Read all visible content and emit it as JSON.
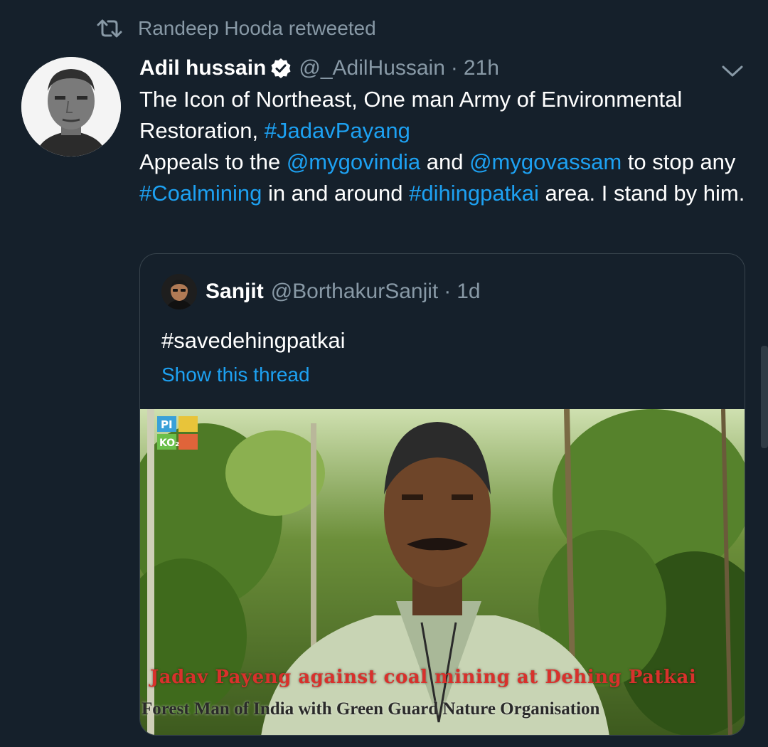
{
  "retweet_context": {
    "text": "Randeep Hooda retweeted"
  },
  "tweet": {
    "author_name": "Adil hussain",
    "author_handle": "@_AdilHussain",
    "separator": "·",
    "time": "21h",
    "verified": true,
    "body": [
      {
        "text": "The Icon of Northeast, One man Army of Environmental Restoration, ",
        "link": false
      },
      {
        "text": "#JadavPayang",
        "link": true
      },
      {
        "text": "\nAppeals to the ",
        "link": false
      },
      {
        "text": "@mygovindia",
        "link": true
      },
      {
        "text": " and ",
        "link": false
      },
      {
        "text": "@mygovassam",
        "link": true
      },
      {
        "text": " to stop any ",
        "link": false
      },
      {
        "text": "#Coalmining",
        "link": true
      },
      {
        "text": " in and around ",
        "link": false
      },
      {
        "text": "#dihingpatkai",
        "link": true
      },
      {
        "text": " area. I stand by him.",
        "link": false
      }
    ]
  },
  "quoted_tweet": {
    "author_name": "Sanjit",
    "author_handle": "@BorthakurSanjit",
    "separator": "·",
    "time": "1d",
    "text": "#savedehingpatkai",
    "show_thread": "Show this thread",
    "media": {
      "caption_red": "Jadav Payeng against coal mining at Dehing Patkai",
      "caption_dark": "Forest Man of India with Green Guard Nature Organisation",
      "watermark": [
        "PI",
        "KO₂"
      ]
    }
  },
  "colors": {
    "background": "#15202b",
    "link": "#1da1f2",
    "secondary_text": "#8899a6",
    "border": "#38444d"
  },
  "icons": {
    "retweet": "retweet-icon",
    "verified": "verified-badge-icon",
    "more": "chevron-down-icon"
  }
}
